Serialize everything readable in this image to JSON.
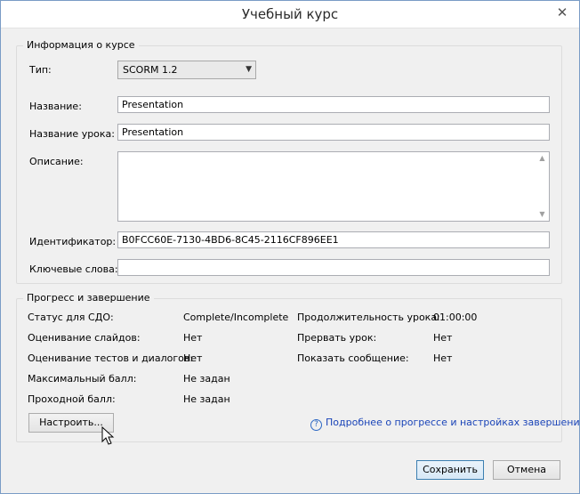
{
  "window": {
    "title": "Учебный курс"
  },
  "course_info": {
    "legend": "Информация о курсе",
    "type_label": "Тип:",
    "type_value": "SCORM 1.2",
    "name_label": "Название:",
    "name_value": "Presentation",
    "lesson_name_label": "Название урока:",
    "lesson_name_value": "Presentation",
    "description_label": "Описание:",
    "description_value": "",
    "identifier_label": "Идентификатор:",
    "identifier_value": "B0FCC60E-7130-4BD6-8C45-2116CF896EE1",
    "keywords_label": "Ключевые слова:",
    "keywords_value": ""
  },
  "progress": {
    "legend": "Прогресс и завершение",
    "lms_status_label": "Статус для СДО:",
    "lms_status_value": "Complete/Incomplete",
    "slide_grading_label": "Оценивание слайдов:",
    "slide_grading_value": "Нет",
    "quiz_grading_label": "Оценивание тестов и диалогов:",
    "quiz_grading_value": "Нет",
    "max_score_label": "Максимальный балл:",
    "max_score_value": "Не задан",
    "passing_score_label": "Проходной балл:",
    "passing_score_value": "Не задан",
    "duration_label": "Продолжительность урока:",
    "duration_value": "01:00:00",
    "interrupt_label": "Прервать урок:",
    "interrupt_value": "Нет",
    "show_message_label": "Показать сообщение:",
    "show_message_value": "Нет",
    "configure_button": "Настроить...",
    "help_link": "Подробнее о прогрессе и настройках завершения"
  },
  "footer": {
    "save_button": "Сохранить",
    "cancel_button": "Отмена"
  },
  "icons": {
    "close": "close-icon",
    "help": "help-icon",
    "dropdown": "chevron-down-icon",
    "cursor": "mouse-pointer-icon"
  }
}
